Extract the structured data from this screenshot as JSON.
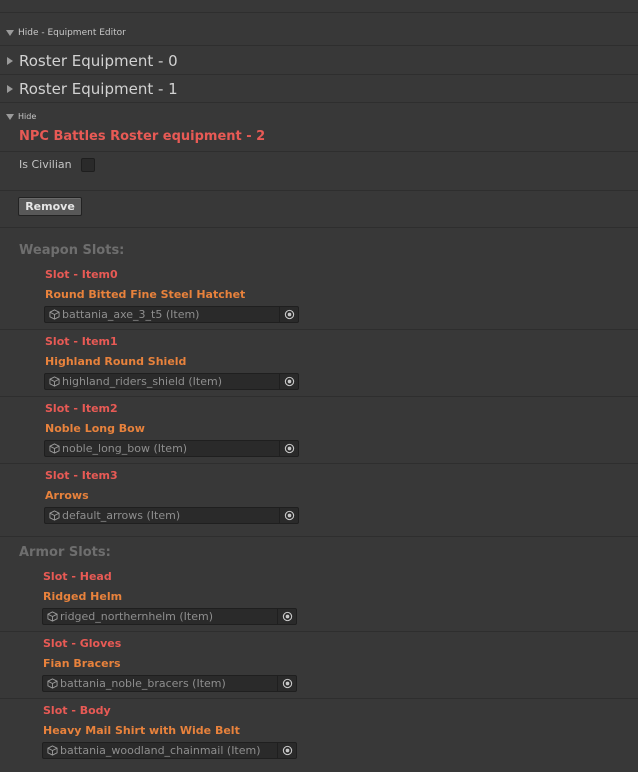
{
  "equipment_editor": {
    "foldout_label": "Hide - Equipment Editor",
    "rosters": [
      {
        "label": "Roster Equipment - 0"
      },
      {
        "label": "Roster Equipment - 1"
      }
    ],
    "hide_label": "Hide",
    "title": "NPC Battles Roster equipment - 2",
    "is_civilian_label": "Is Civilian",
    "is_civilian_checked": false,
    "remove_button_label": "Remove"
  },
  "weapon_slots": {
    "header": "Weapon Slots:",
    "slots": [
      {
        "slot": "Slot - Item0",
        "name": "Round Bitted Fine Steel Hatchet",
        "value": "battania_axe_3_t5 (Item)"
      },
      {
        "slot": "Slot - Item1",
        "name": "Highland Round Shield",
        "value": "highland_riders_shield (Item)"
      },
      {
        "slot": "Slot - Item2",
        "name": "Noble Long Bow",
        "value": "noble_long_bow (Item)"
      },
      {
        "slot": "Slot - Item3",
        "name": "Arrows",
        "value": "default_arrows (Item)"
      }
    ]
  },
  "armor_slots": {
    "header": "Armor Slots:",
    "slots": [
      {
        "slot": "Slot - Head",
        "name": "Ridged Helm",
        "value": "ridged_northernhelm (Item)"
      },
      {
        "slot": "Slot - Gloves",
        "name": "Fian Bracers",
        "value": "battania_noble_bracers (Item)"
      },
      {
        "slot": "Slot - Body",
        "name": "Heavy Mail Shirt with Wide Belt",
        "value": "battania_woodland_chainmail (Item)"
      }
    ]
  },
  "icons": {
    "expanded": "triangle-down-icon",
    "collapsed": "triangle-right-icon",
    "object": "cube-icon",
    "picker": "target-picker-icon"
  },
  "colors": {
    "background": "#383838",
    "title_red": "#e85a55",
    "item_orange": "#e8823c",
    "section_gray": "#6e6e6e"
  }
}
